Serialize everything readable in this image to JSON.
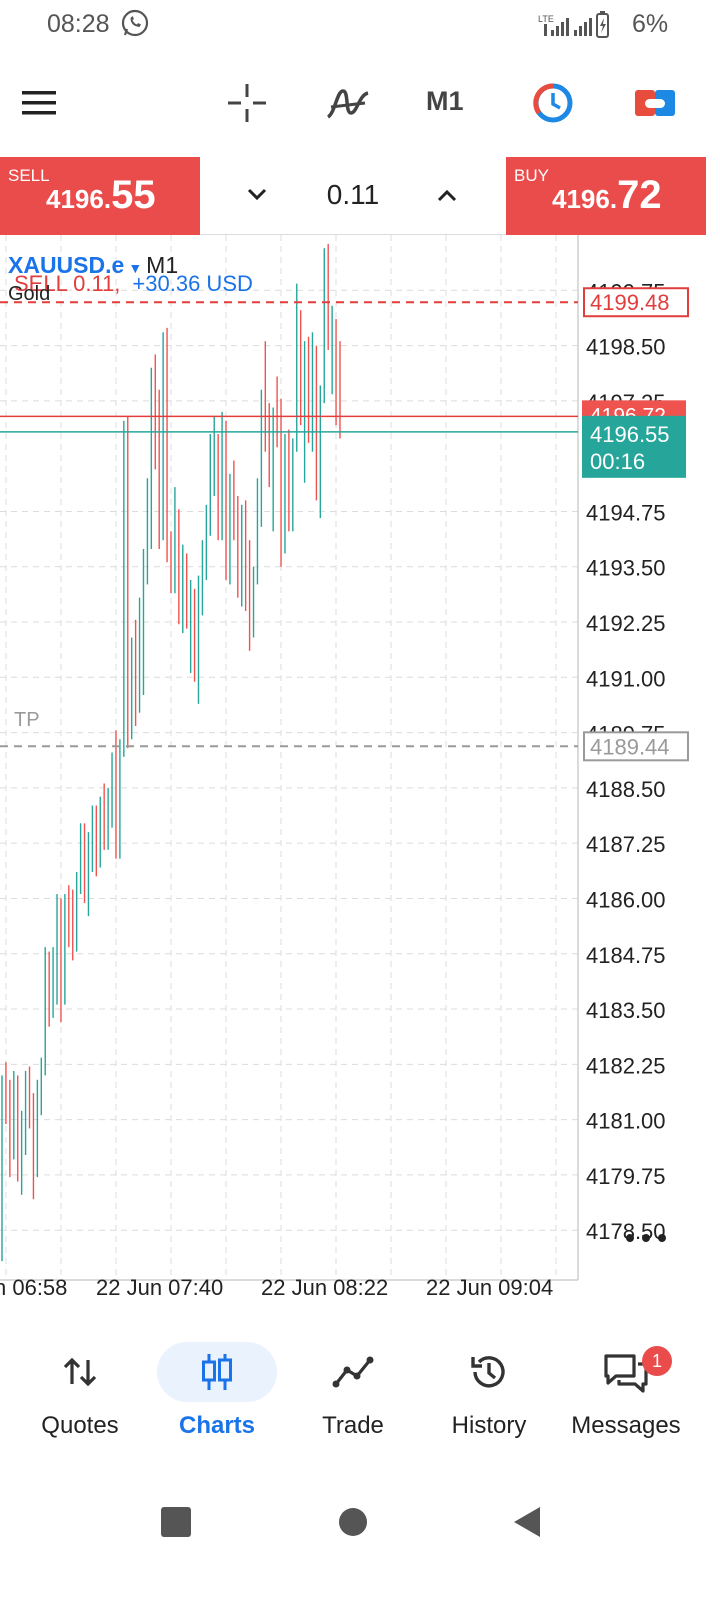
{
  "status_bar": {
    "time": "08:28",
    "battery": "6%",
    "network": "LTE"
  },
  "toolbar": {
    "period": "M1",
    "icons": [
      "menu-icon",
      "crosshair-icon",
      "indicators-icon",
      "timeframe-m1",
      "chart-clock-icon",
      "trade-toggle-icon"
    ]
  },
  "trade_panel": {
    "sell_label": "SELL",
    "sell_price_small": "4196.",
    "sell_price_big": "55",
    "lot": "0.11",
    "buy_label": "BUY",
    "buy_price_small": "4196.",
    "buy_price_big": "72"
  },
  "chart": {
    "symbol": "XAUUSD.e",
    "timeframe": "M1",
    "description": "Gold",
    "order_text": "SELL 0.11,",
    "order_profit": "+30.36 USD",
    "tp_label": "TP",
    "sl_price": "4199.48",
    "tp_price": "4189.44",
    "bid_price": "4196.55",
    "bid_timer": "00:16",
    "ask_partial": "4196.72",
    "colors": {
      "up": "#26a69a",
      "down": "#ef5350",
      "sl": "#e23d3d",
      "tp": "#9a9a9a",
      "bid_bg": "#26a69a"
    }
  },
  "chart_data": {
    "type": "candlestick",
    "ylim": [
      4177.6,
      4201.0
    ],
    "y_ticks": [
      "4199.75",
      "4198.50",
      "4197.25",
      "4194.75",
      "4193.50",
      "4192.25",
      "4191.00",
      "4189.75",
      "4188.50",
      "4187.25",
      "4186.00",
      "4184.75",
      "4183.50",
      "4182.25",
      "4181.00",
      "4179.75",
      "4178.50"
    ],
    "x_ticks": [
      "n 06:58",
      "22 Jun 07:40",
      "22 Jun 08:22",
      "22 Jun 09:04"
    ],
    "sell_entry": 4196.9,
    "bid": 4196.55,
    "stop_loss": 4199.48,
    "take_profit": 4189.44,
    "candles": [
      [
        4181.5,
        4182.0,
        4177.8,
        4181.8
      ],
      [
        4181.8,
        4182.3,
        4180.9,
        4181.1
      ],
      [
        4181.1,
        4181.9,
        4179.7,
        4180.5
      ],
      [
        4180.5,
        4182.1,
        4180.1,
        4181.9
      ],
      [
        4181.9,
        4182.0,
        4179.6,
        4180.4
      ],
      [
        4180.4,
        4181.2,
        4179.3,
        4180.9
      ],
      [
        4180.9,
        4182.1,
        4180.2,
        4181.6
      ],
      [
        4181.6,
        4182.2,
        4180.8,
        4181.2
      ],
      [
        4181.2,
        4181.6,
        4179.2,
        4179.9
      ],
      [
        4179.9,
        4181.9,
        4179.7,
        4181.4
      ],
      [
        4181.4,
        4182.4,
        4181.1,
        4182.2
      ],
      [
        4182.2,
        4184.9,
        4182.0,
        4184.6
      ],
      [
        4184.6,
        4184.8,
        4183.1,
        4183.6
      ],
      [
        4183.6,
        4184.9,
        4183.3,
        4184.4
      ],
      [
        4184.4,
        4186.1,
        4183.6,
        4185.9
      ],
      [
        4185.9,
        4186.0,
        4183.2,
        4183.8
      ],
      [
        4183.8,
        4186.1,
        4183.6,
        4185.7
      ],
      [
        4185.7,
        4186.3,
        4184.9,
        4185.5
      ],
      [
        4185.5,
        4186.2,
        4184.6,
        4185.2
      ],
      [
        4185.2,
        4186.6,
        4184.8,
        4186.4
      ],
      [
        4186.4,
        4187.7,
        4186.1,
        4187.5
      ],
      [
        4187.5,
        4187.7,
        4185.9,
        4186.2
      ],
      [
        4186.2,
        4187.5,
        4185.6,
        4187.1
      ],
      [
        4187.1,
        4188.1,
        4186.6,
        4187.8
      ],
      [
        4187.8,
        4188.1,
        4186.5,
        4186.9
      ],
      [
        4186.9,
        4188.3,
        4186.7,
        4188.2
      ],
      [
        4188.2,
        4188.6,
        4187.1,
        4187.4
      ],
      [
        4187.4,
        4188.5,
        4187.1,
        4187.9
      ],
      [
        4187.9,
        4189.3,
        4187.6,
        4189.0
      ],
      [
        4189.0,
        4189.8,
        4186.9,
        4187.3
      ],
      [
        4187.3,
        4189.6,
        4186.9,
        4189.4
      ],
      [
        4189.4,
        4196.8,
        4189.2,
        4196.6
      ],
      [
        4196.6,
        4196.9,
        4189.4,
        4190.2
      ],
      [
        4190.2,
        4191.9,
        4189.6,
        4191.6
      ],
      [
        4191.6,
        4192.3,
        4189.9,
        4190.5
      ],
      [
        4190.5,
        4192.8,
        4190.2,
        4192.6
      ],
      [
        4192.6,
        4193.9,
        4190.6,
        4193.7
      ],
      [
        4193.7,
        4195.5,
        4193.1,
        4195.1
      ],
      [
        4195.1,
        4198.0,
        4193.9,
        4197.4
      ],
      [
        4197.4,
        4198.3,
        4195.7,
        4196.1
      ],
      [
        4196.1,
        4197.5,
        4193.9,
        4194.4
      ],
      [
        4194.4,
        4198.8,
        4194.1,
        4198.6
      ],
      [
        4198.6,
        4198.9,
        4193.6,
        4194.0
      ],
      [
        4194.0,
        4194.3,
        4192.9,
        4193.2
      ],
      [
        4193.2,
        4195.3,
        4192.9,
        4194.6
      ],
      [
        4194.6,
        4194.8,
        4192.2,
        4192.4
      ],
      [
        4192.4,
        4194.0,
        4192.0,
        4193.5
      ],
      [
        4193.5,
        4193.8,
        4192.1,
        4192.2
      ],
      [
        4192.2,
        4193.2,
        4191.1,
        4192.9
      ],
      [
        4192.9,
        4193.0,
        4190.9,
        4191.3
      ],
      [
        4191.3,
        4193.3,
        4190.4,
        4192.7
      ],
      [
        4192.7,
        4194.1,
        4192.4,
        4193.8
      ],
      [
        4193.8,
        4194.9,
        4193.2,
        4194.5
      ],
      [
        4194.5,
        4196.5,
        4194.2,
        4196.1
      ],
      [
        4196.1,
        4196.9,
        4195.1,
        4196.3
      ],
      [
        4196.3,
        4196.5,
        4194.1,
        4194.6
      ],
      [
        4194.6,
        4197.0,
        4194.1,
        4196.6
      ],
      [
        4196.6,
        4196.8,
        4193.2,
        4194.0
      ],
      [
        4194.0,
        4195.6,
        4193.1,
        4195.4
      ],
      [
        4195.4,
        4195.9,
        4194.1,
        4194.5
      ],
      [
        4194.5,
        4195.1,
        4192.8,
        4193.1
      ],
      [
        4193.1,
        4194.9,
        4192.6,
        4194.5
      ],
      [
        4194.5,
        4195.0,
        4192.5,
        4192.7
      ],
      [
        4192.7,
        4194.1,
        4191.6,
        4192.2
      ],
      [
        4192.2,
        4193.5,
        4191.9,
        4193.4
      ],
      [
        4193.4,
        4195.5,
        4193.1,
        4195.1
      ],
      [
        4195.1,
        4197.5,
        4194.4,
        4196.8
      ],
      [
        4196.8,
        4198.6,
        4196.1,
        4196.6
      ],
      [
        4196.6,
        4197.2,
        4195.3,
        4195.9
      ],
      [
        4195.9,
        4197.1,
        4194.3,
        4196.9
      ],
      [
        4196.9,
        4197.8,
        4196.2,
        4196.6
      ],
      [
        4196.6,
        4197.3,
        4193.5,
        4194.0
      ],
      [
        4194.0,
        4196.5,
        4193.8,
        4196.2
      ],
      [
        4196.2,
        4196.6,
        4194.3,
        4194.6
      ],
      [
        4194.6,
        4196.4,
        4194.3,
        4196.3
      ],
      [
        4196.3,
        4199.9,
        4196.1,
        4198.9
      ],
      [
        4198.9,
        4199.3,
        4196.7,
        4197.1
      ],
      [
        4197.1,
        4198.6,
        4195.4,
        4198.4
      ],
      [
        4198.4,
        4198.7,
        4196.3,
        4197.0
      ],
      [
        4197.0,
        4198.8,
        4196.1,
        4198.3
      ],
      [
        4198.3,
        4198.5,
        4195.0,
        4195.3
      ],
      [
        4195.3,
        4197.6,
        4194.6,
        4197.4
      ],
      [
        4197.4,
        4200.7,
        4197.2,
        4199.6
      ],
      [
        4199.6,
        4200.8,
        4198.4,
        4198.6
      ],
      [
        4198.6,
        4199.4,
        4197.4,
        4198.9
      ],
      [
        4198.9,
        4199.1,
        4196.7,
        4197.4
      ],
      [
        4197.4,
        4198.6,
        4196.4,
        4196.6
      ]
    ]
  },
  "bottom_nav": {
    "items": [
      {
        "label": "Quotes",
        "icon": "quotes-icon"
      },
      {
        "label": "Charts",
        "icon": "charts-icon",
        "active": true
      },
      {
        "label": "Trade",
        "icon": "trade-icon"
      },
      {
        "label": "History",
        "icon": "history-icon"
      },
      {
        "label": "Messages",
        "icon": "messages-icon",
        "badge": "1"
      }
    ]
  }
}
